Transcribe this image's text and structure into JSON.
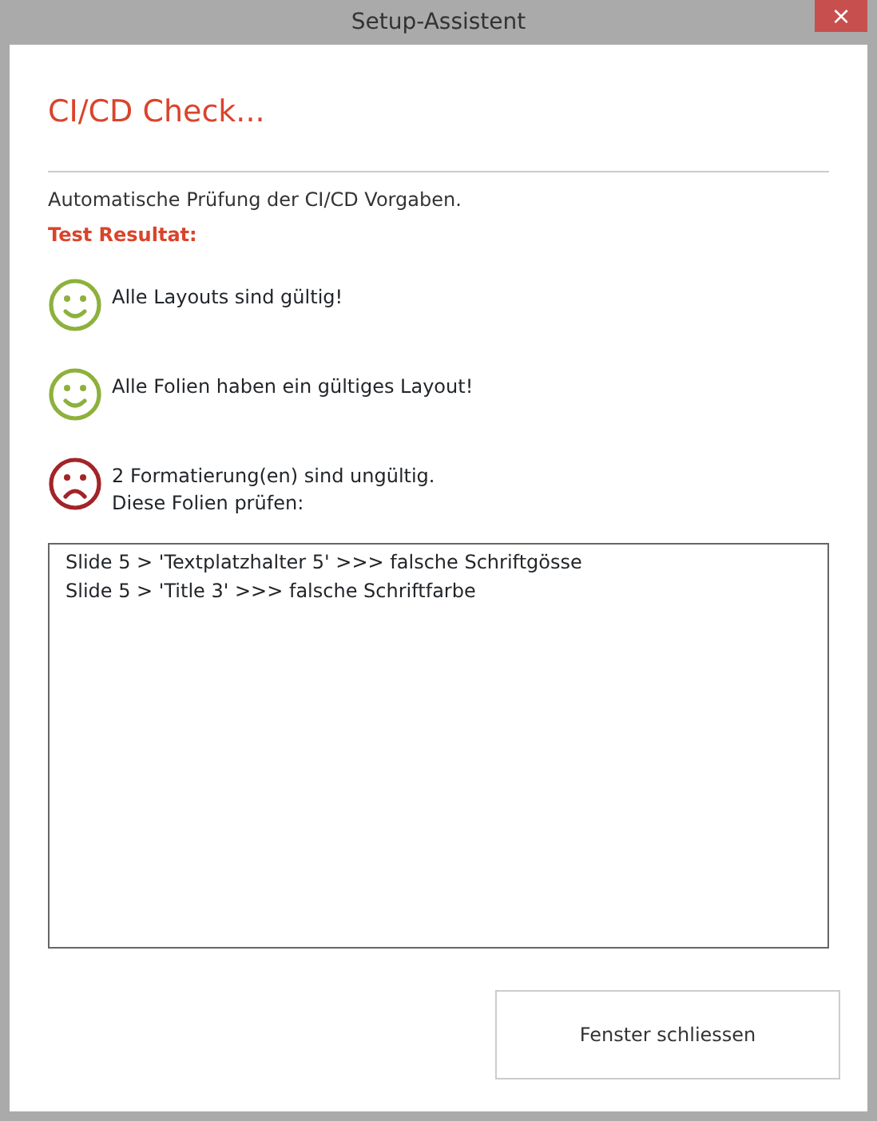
{
  "window": {
    "title": "Setup-Assistent",
    "close": "×"
  },
  "heading": "CI/CD Check...",
  "description": "Automatische Prüfung der CI/CD Vorgaben.",
  "result_label": "Test Resultat:",
  "results": [
    {
      "kind": "pass",
      "lines": [
        "Alle Layouts sind gültig!"
      ]
    },
    {
      "kind": "pass",
      "lines": [
        "Alle Folien haben ein gültiges Layout!"
      ]
    },
    {
      "kind": "fail",
      "lines": [
        "2 Formatierung(en) sind ungültig.",
        "Diese Folien prüfen:"
      ]
    }
  ],
  "issues": [
    "Slide 5 > 'Textplatzhalter 5' >>> falsche Schriftgösse",
    "Slide 5 > 'Title 3' >>> falsche Schriftfarbe"
  ],
  "buttons": [
    "Fenster schliessen"
  ]
}
